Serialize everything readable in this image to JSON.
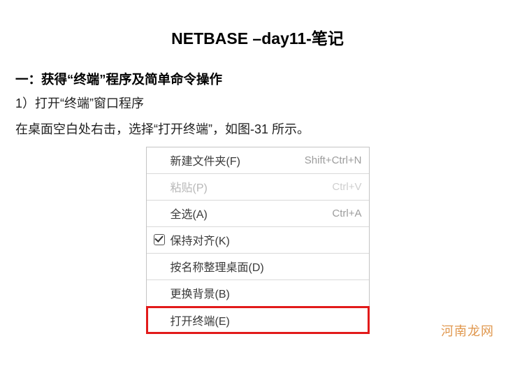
{
  "title": "NETBASE –day11-笔记",
  "section_heading": "一：获得“终端”程序及简单命令操作",
  "body_line_1": "1）打开“终端”窗口程序",
  "body_line_2": "在桌面空白处右击，选择“打开终端”，如图-31 所示。",
  "menu": {
    "items": [
      {
        "label": "新建文件夹(F)",
        "shortcut": "Shift+Ctrl+N",
        "disabled": false,
        "checkbox": false,
        "highlighted": false
      },
      {
        "label": "粘贴(P)",
        "shortcut": "Ctrl+V",
        "disabled": true,
        "checkbox": false,
        "highlighted": false
      },
      {
        "label": "全选(A)",
        "shortcut": "Ctrl+A",
        "disabled": false,
        "checkbox": false,
        "highlighted": false
      },
      {
        "label": "保持对齐(K)",
        "shortcut": "",
        "disabled": false,
        "checkbox": true,
        "highlighted": false
      },
      {
        "label": "按名称整理桌面(D)",
        "shortcut": "",
        "disabled": false,
        "checkbox": false,
        "highlighted": false
      },
      {
        "label": "更换背景(B)",
        "shortcut": "",
        "disabled": false,
        "checkbox": false,
        "highlighted": false
      },
      {
        "label": "打开终端(E)",
        "shortcut": "",
        "disabled": false,
        "checkbox": false,
        "highlighted": true
      }
    ]
  },
  "watermark": "河南龙网"
}
